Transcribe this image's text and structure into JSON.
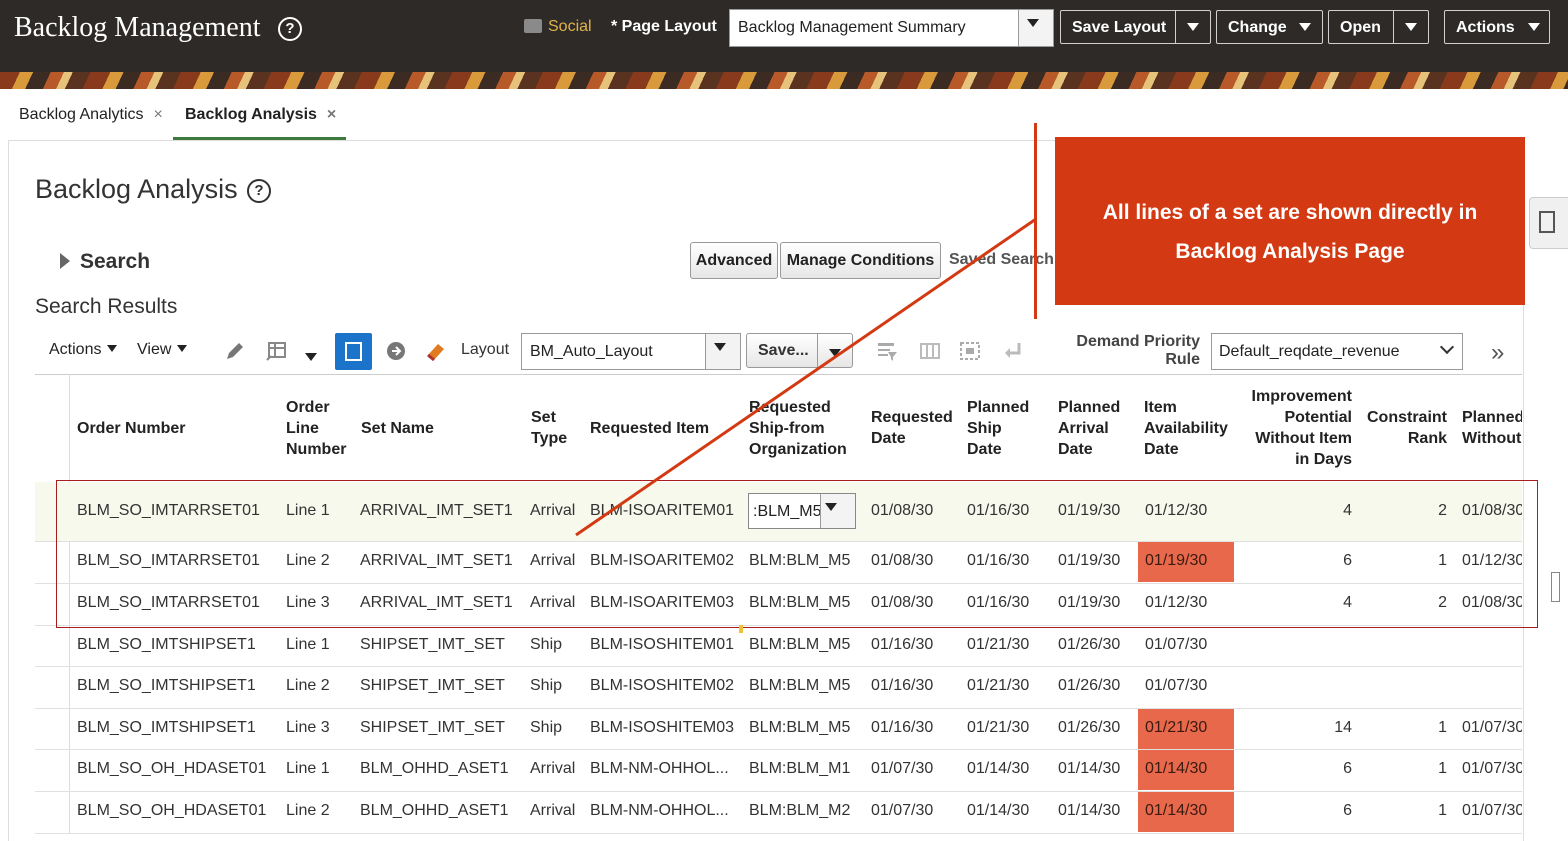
{
  "header": {
    "app_title": "Backlog Management",
    "social": "Social",
    "page_layout_label": "* Page Layout",
    "page_layout_value": "Backlog Management Summary",
    "buttons": {
      "save_layout": "Save Layout",
      "change": "Change",
      "open": "Open",
      "actions": "Actions"
    }
  },
  "tabs": [
    {
      "label": "Backlog Analytics",
      "close": "×"
    },
    {
      "label": "Backlog Analysis",
      "close": "×"
    }
  ],
  "page": {
    "title": "Backlog Analysis",
    "search_label": "Search",
    "advanced": "Advanced",
    "manage_conditions": "Manage Conditions",
    "saved_search": "Saved Search",
    "results_title": "Search Results"
  },
  "toolbar": {
    "actions": "Actions",
    "view": "View",
    "layout_label": "Layout",
    "layout_value": "BM_Auto_Layout",
    "save": "Save...",
    "dpr_label_1": "Demand Priority",
    "dpr_label_2": "Rule",
    "dpr_value": "Default_reqdate_revenue",
    "more": "»"
  },
  "columns": {
    "order_number": "Order Number",
    "order_line_number": [
      "Order",
      "Line",
      "Number"
    ],
    "set_name": "Set Name",
    "set_type": [
      "Set",
      "Type"
    ],
    "requested_item": "Requested Item",
    "ship_from_org": [
      "Requested",
      "Ship-from",
      "Organization"
    ],
    "requested_date": [
      "Requested",
      "Date"
    ],
    "planned_ship_date": [
      "Planned",
      "Ship",
      "Date"
    ],
    "planned_arrival_date": [
      "Planned",
      "Arrival",
      "Date"
    ],
    "item_availability_date": [
      "Item",
      "Availability",
      "Date"
    ],
    "improvement_potential": [
      "Improvement",
      "Potential",
      "Without Item",
      "in Days"
    ],
    "constraint_rank": [
      "Constraint",
      "Rank"
    ],
    "planned_without": [
      "Planned",
      "Without"
    ]
  },
  "rows": [
    {
      "order": "BLM_SO_IMTARRSET01",
      "line": "Line 1",
      "set": "ARRIVAL_IMT_SET1",
      "type": "Arrival",
      "item": "BLM-ISOARITEM01",
      "org": ":BLM_M5",
      "req": "01/08/30",
      "ship": "01/16/30",
      "arr": "01/19/30",
      "avail": "01/12/30",
      "impr": "4",
      "rank": "2",
      "pw": "01/08/30"
    },
    {
      "order": "BLM_SO_IMTARRSET01",
      "line": "Line 2",
      "set": "ARRIVAL_IMT_SET1",
      "type": "Arrival",
      "item": "BLM-ISOARITEM02",
      "org": "BLM:BLM_M5",
      "req": "01/08/30",
      "ship": "01/16/30",
      "arr": "01/19/30",
      "avail": "01/19/30",
      "impr": "6",
      "rank": "1",
      "pw": "01/12/30"
    },
    {
      "order": "BLM_SO_IMTARRSET01",
      "line": "Line 3",
      "set": "ARRIVAL_IMT_SET1",
      "type": "Arrival",
      "item": "BLM-ISOARITEM03",
      "org": "BLM:BLM_M5",
      "req": "01/08/30",
      "ship": "01/16/30",
      "arr": "01/19/30",
      "avail": "01/12/30",
      "impr": "4",
      "rank": "2",
      "pw": "01/08/30"
    },
    {
      "order": "BLM_SO_IMTSHIPSET1",
      "line": "Line 1",
      "set": "SHIPSET_IMT_SET",
      "type": "Ship",
      "item": "BLM-ISOSHITEM01",
      "org": "BLM:BLM_M5",
      "req": "01/16/30",
      "ship": "01/21/30",
      "arr": "01/26/30",
      "avail": "01/07/30",
      "impr": "",
      "rank": "",
      "pw": ""
    },
    {
      "order": "BLM_SO_IMTSHIPSET1",
      "line": "Line 2",
      "set": "SHIPSET_IMT_SET",
      "type": "Ship",
      "item": "BLM-ISOSHITEM02",
      "org": "BLM:BLM_M5",
      "req": "01/16/30",
      "ship": "01/21/30",
      "arr": "01/26/30",
      "avail": "01/07/30",
      "impr": "",
      "rank": "",
      "pw": ""
    },
    {
      "order": "BLM_SO_IMTSHIPSET1",
      "line": "Line 3",
      "set": "SHIPSET_IMT_SET",
      "type": "Ship",
      "item": "BLM-ISOSHITEM03",
      "org": "BLM:BLM_M5",
      "req": "01/16/30",
      "ship": "01/21/30",
      "arr": "01/26/30",
      "avail": "01/21/30",
      "impr": "14",
      "rank": "1",
      "pw": "01/07/30"
    },
    {
      "order": "BLM_SO_OH_HDASET01",
      "line": "Line 1",
      "set": "BLM_OHHD_ASET1",
      "type": "Arrival",
      "item": "BLM-NM-OHHOL...",
      "org": "BLM:BLM_M1",
      "req": "01/07/30",
      "ship": "01/14/30",
      "arr": "01/14/30",
      "avail": "01/14/30",
      "impr": "6",
      "rank": "1",
      "pw": "01/07/30"
    },
    {
      "order": "BLM_SO_OH_HDASET01",
      "line": "Line 2",
      "set": "BLM_OHHD_ASET1",
      "type": "Arrival",
      "item": "BLM-NM-OHHOL...",
      "org": "BLM:BLM_M2",
      "req": "01/07/30",
      "ship": "01/14/30",
      "arr": "01/14/30",
      "avail": "01/14/30",
      "impr": "6",
      "rank": "1",
      "pw": "01/07/30"
    }
  ],
  "highlighted_rows": [
    1,
    5,
    6,
    7
  ],
  "callout": {
    "line1": "All lines of a set are shown directly in",
    "line2": "Backlog Analysis Page"
  },
  "colors": {
    "header_bg": "#2d2a27",
    "highlight_red": "#e8684b",
    "callout": "#d33a13",
    "selected_row": "#f7f9ec",
    "accent_blue": "#1b74c9"
  }
}
